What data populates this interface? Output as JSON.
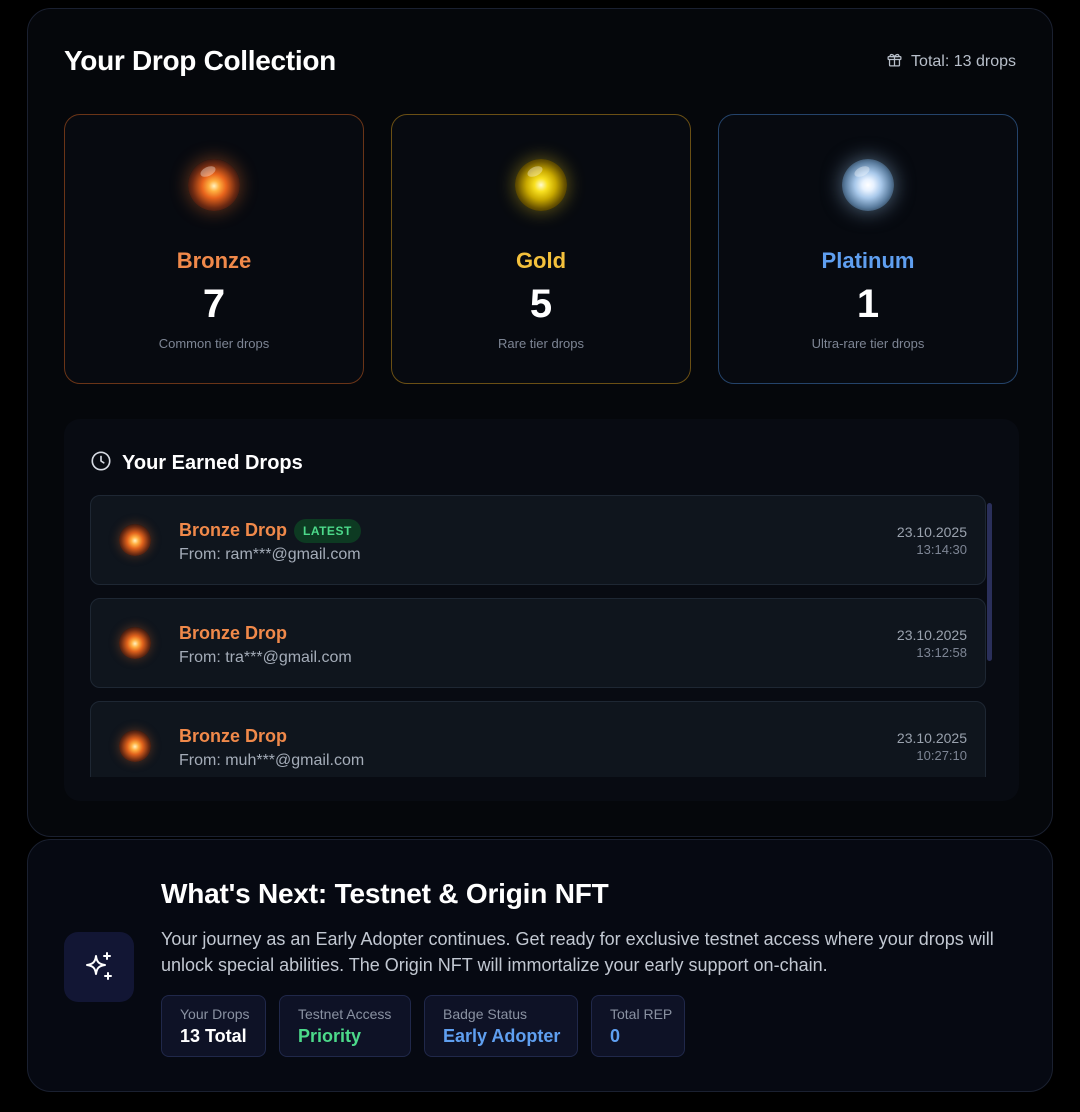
{
  "collection": {
    "title": "Your Drop Collection",
    "total_label": "Total: 13 drops",
    "total_icon": "gift-icon",
    "tiers": [
      {
        "name": "Bronze",
        "count": "7",
        "description": "Common tier drops",
        "color": "#f0894a",
        "icon": "bronze-orb-icon"
      },
      {
        "name": "Gold",
        "count": "5",
        "description": "Rare tier drops",
        "color": "#f4c13c",
        "icon": "gold-orb-icon"
      },
      {
        "name": "Platinum",
        "count": "1",
        "description": "Ultra-rare tier drops",
        "color": "#5f9ff0",
        "icon": "platinum-orb-icon"
      }
    ]
  },
  "earned": {
    "title": "Your Earned Drops",
    "icon": "clock-icon",
    "latest_badge": "LATEST",
    "drops": [
      {
        "name": "Bronze Drop",
        "from": "From: ram***@gmail.com",
        "date": "23.10.2025",
        "time": "13:14:30",
        "latest": true
      },
      {
        "name": "Bronze Drop",
        "from": "From: tra***@gmail.com",
        "date": "23.10.2025",
        "time": "13:12:58",
        "latest": false
      },
      {
        "name": "Bronze Drop",
        "from": "From: muh***@gmail.com",
        "date": "23.10.2025",
        "time": "10:27:10",
        "latest": false
      }
    ]
  },
  "next": {
    "icon": "sparkles-icon",
    "title": "What's Next: Testnet & Origin NFT",
    "description": "Your journey as an Early Adopter continues. Get ready for exclusive testnet access where your drops will unlock special abilities. The Origin NFT will immortalize your early support on-chain.",
    "stats": [
      {
        "label": "Your Drops",
        "value": "13 Total",
        "color": "#ffffff"
      },
      {
        "label": "Testnet Access",
        "value": "Priority",
        "color": "#4cd98a"
      },
      {
        "label": "Badge Status",
        "value": "Early Adopter",
        "color": "#5f9ff0"
      },
      {
        "label": "Total REP",
        "value": "0",
        "color": "#5f9ff0"
      }
    ]
  }
}
